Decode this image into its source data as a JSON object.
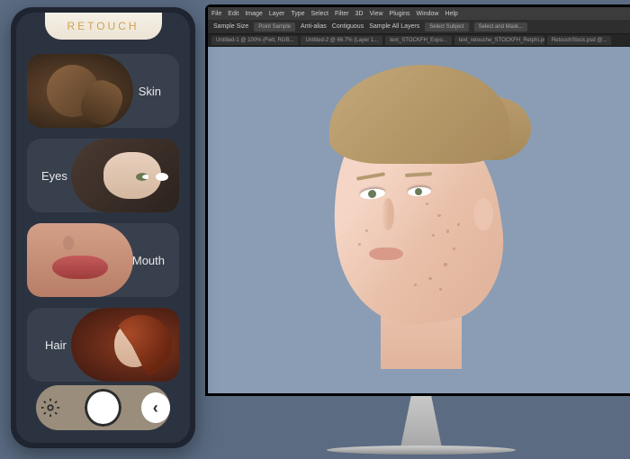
{
  "phone": {
    "title": "RETOUCH",
    "cards": [
      {
        "label": "Skin"
      },
      {
        "label": "Eyes"
      },
      {
        "label": "Mouth"
      },
      {
        "label": "Hair"
      }
    ]
  },
  "photoshop": {
    "menu": [
      "File",
      "Edit",
      "Image",
      "Layer",
      "Type",
      "Select",
      "Filter",
      "3D",
      "View",
      "Plugins",
      "Window",
      "Help"
    ],
    "toolbar": {
      "tool": "Sample Size",
      "opt1": "Point Sample",
      "opt2": "Anti-alias",
      "opt3": "Contiguous",
      "opt4": "Sample All Layers",
      "btn1": "Select Subject",
      "btn2": "Select and Mask..."
    },
    "tabs": [
      "Untitled-1 @ 100% (Fwtl, RGB...",
      "Untitled-2 @ 66.7% (Layer 1...",
      "text_STOCKFH_Expo...",
      "text_retouche_STOCKFH_Retphi.psd...",
      "RetouchStock.psd @..."
    ]
  }
}
